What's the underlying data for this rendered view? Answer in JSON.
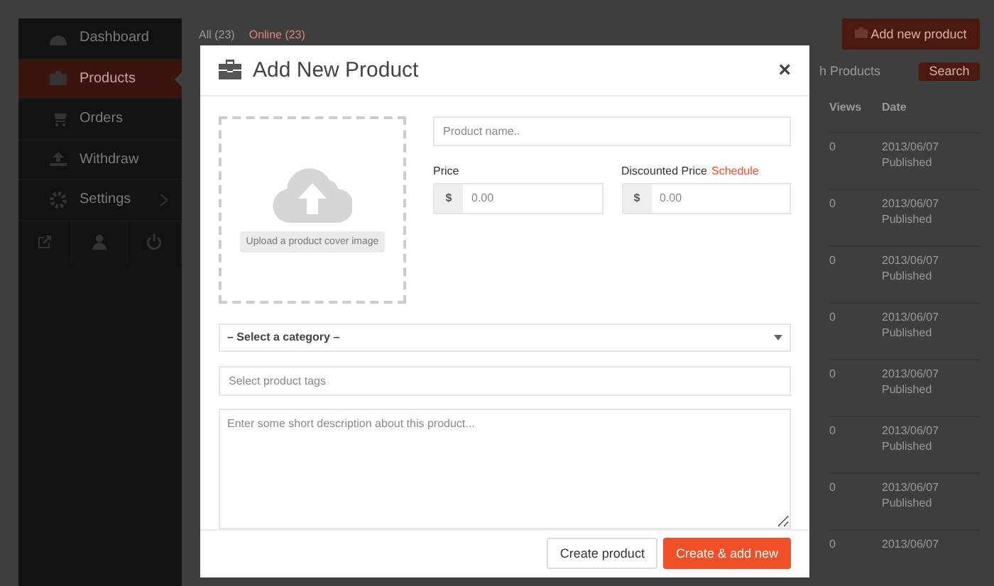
{
  "sidebar": {
    "items": [
      {
        "label": "Dashboard",
        "selected": false,
        "expandable": false
      },
      {
        "label": "Products",
        "selected": true,
        "expandable": false
      },
      {
        "label": "Orders",
        "selected": false,
        "expandable": false
      },
      {
        "label": "Withdraw",
        "selected": false,
        "expandable": false
      },
      {
        "label": "Settings",
        "selected": false,
        "expandable": true
      }
    ]
  },
  "filters": [
    {
      "label": "All (23)",
      "selected": false
    },
    {
      "label": "Online (23)",
      "selected": true
    }
  ],
  "add_button": "Add new product",
  "search": {
    "placeholder": "h Products",
    "button": "Search"
  },
  "table": {
    "columns": [
      "Views",
      "Date"
    ],
    "rows": [
      {
        "views": "0",
        "date": "2013/06/07",
        "status": "Published"
      },
      {
        "views": "0",
        "date": "2013/06/07",
        "status": "Published"
      },
      {
        "views": "0",
        "date": "2013/06/07",
        "status": "Published"
      },
      {
        "views": "0",
        "date": "2013/06/07",
        "status": "Published"
      },
      {
        "views": "0",
        "date": "2013/06/07",
        "status": "Published"
      },
      {
        "views": "0",
        "date": "2013/06/07",
        "status": "Published"
      },
      {
        "views": "0",
        "date": "2013/06/07",
        "status": "Published"
      },
      {
        "views": "0",
        "date": "2013/06/07"
      }
    ]
  },
  "modal": {
    "title": "Add New Product",
    "close": "×",
    "upload_label": "Upload a product cover image",
    "name_placeholder": "Product name..",
    "price": {
      "label": "Price",
      "currency": "$",
      "placeholder": "0.00"
    },
    "discount": {
      "label": "Discounted Price",
      "link": "Schedule",
      "currency": "$",
      "placeholder": "0.00"
    },
    "category": "– Select a category –",
    "tags_placeholder": "Select product tags",
    "description_placeholder": "Enter some short description about this product...",
    "buttons": [
      {
        "label": "Create product",
        "kind": "default"
      },
      {
        "label": "Create & add new",
        "kind": "primary"
      }
    ]
  }
}
